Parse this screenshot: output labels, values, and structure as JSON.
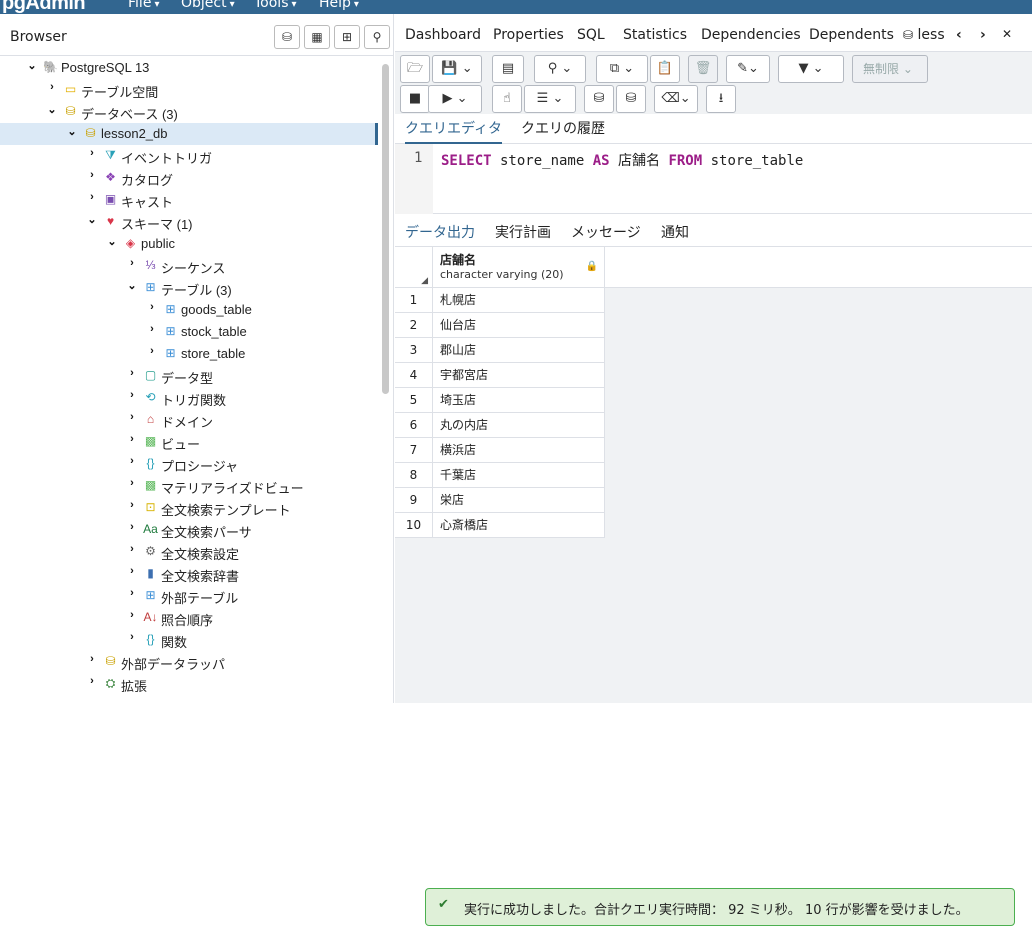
{
  "app": {
    "logo_text": "pgAdmin",
    "menu": [
      {
        "label": "File"
      },
      {
        "label": "Object"
      },
      {
        "label": "Tools"
      },
      {
        "label": "Help"
      }
    ]
  },
  "browser": {
    "title": "Browser",
    "tree": [
      {
        "label": "PostgreSQL 13",
        "icon": "server-icon",
        "expanded": true
      },
      {
        "label": "テーブル空間",
        "icon": "folder-icon",
        "expanded": false
      },
      {
        "label": "データベース (3)",
        "icon": "database-icon",
        "expanded": true
      },
      {
        "label": "lesson2_db",
        "icon": "database-icon",
        "expanded": true,
        "selected": true
      },
      {
        "label": "イベントトリガ",
        "icon": "event-trigger-icon",
        "expanded": false
      },
      {
        "label": "カタログ",
        "icon": "catalog-icon",
        "expanded": false
      },
      {
        "label": "キャスト",
        "icon": "cast-icon",
        "expanded": false
      },
      {
        "label": "スキーマ (1)",
        "icon": "schema-icon",
        "expanded": true
      },
      {
        "label": "public",
        "icon": "schema-public-icon",
        "expanded": true
      },
      {
        "label": "シーケンス",
        "icon": "sequence-icon",
        "expanded": false
      },
      {
        "label": "テーブル (3)",
        "icon": "tables-icon",
        "expanded": true
      },
      {
        "label": "goods_table",
        "icon": "table-icon",
        "expanded": false
      },
      {
        "label": "stock_table",
        "icon": "table-icon",
        "expanded": false
      },
      {
        "label": "store_table",
        "icon": "table-icon",
        "expanded": false
      },
      {
        "label": "データ型",
        "icon": "datatype-icon",
        "expanded": false
      },
      {
        "label": "トリガ関数",
        "icon": "trigger-function-icon",
        "expanded": false
      },
      {
        "label": "ドメイン",
        "icon": "domain-icon",
        "expanded": false
      },
      {
        "label": "ビュー",
        "icon": "view-icon",
        "expanded": false
      },
      {
        "label": "プロシージャ",
        "icon": "procedure-icon",
        "expanded": false
      },
      {
        "label": "マテリアライズドビュー",
        "icon": "materialized-view-icon",
        "expanded": false
      },
      {
        "label": "全文検索テンプレート",
        "icon": "fts-template-icon",
        "expanded": false
      },
      {
        "label": "全文検索パーサ",
        "icon": "fts-parser-icon",
        "expanded": false
      },
      {
        "label": "全文検索設定",
        "icon": "fts-config-icon",
        "expanded": false
      },
      {
        "label": "全文検索辞書",
        "icon": "fts-dictionary-icon",
        "expanded": false
      },
      {
        "label": "外部テーブル",
        "icon": "foreign-table-icon",
        "expanded": false
      },
      {
        "label": "照合順序",
        "icon": "collation-icon",
        "expanded": false
      },
      {
        "label": "関数",
        "icon": "function-icon",
        "expanded": false
      },
      {
        "label": "外部データラッパ",
        "icon": "fdw-icon",
        "expanded": false
      },
      {
        "label": "拡張",
        "icon": "extension-icon",
        "expanded": false
      }
    ]
  },
  "main_tabs": [
    {
      "label": "Dashboard"
    },
    {
      "label": "Properties"
    },
    {
      "label": "SQL"
    },
    {
      "label": "Statistics"
    },
    {
      "label": "Dependencies"
    },
    {
      "label": "Dependents"
    },
    {
      "label": "less"
    }
  ],
  "toolbar": {
    "limit_value": "無制限"
  },
  "query_tabs": [
    {
      "label": "クエリエディタ",
      "active": true
    },
    {
      "label": "クエリの履歴",
      "active": false
    }
  ],
  "editor": {
    "line_number": "1",
    "tokens": {
      "select": "SELECT",
      "col": " store_name ",
      "as": "AS",
      "alias": " 店舗名 ",
      "from": "FROM",
      "table": " store_table"
    }
  },
  "output_tabs": [
    {
      "label": "データ出力",
      "active": true
    },
    {
      "label": "実行計画",
      "active": false
    },
    {
      "label": "メッセージ",
      "active": false
    },
    {
      "label": "通知",
      "active": false
    }
  ],
  "result": {
    "column": {
      "name": "店舗名",
      "type": "character varying (20)"
    },
    "rows": [
      {
        "n": "1",
        "v": "札幌店"
      },
      {
        "n": "2",
        "v": "仙台店"
      },
      {
        "n": "3",
        "v": "郡山店"
      },
      {
        "n": "4",
        "v": "宇都宮店"
      },
      {
        "n": "5",
        "v": "埼玉店"
      },
      {
        "n": "6",
        "v": "丸の内店"
      },
      {
        "n": "7",
        "v": "横浜店"
      },
      {
        "n": "8",
        "v": "千葉店"
      },
      {
        "n": "9",
        "v": "栄店"
      },
      {
        "n": "10",
        "v": "心斎橋店"
      }
    ]
  },
  "status": {
    "message": "実行に成功しました。合計クエリ実行時間： 92 ミリ秒。 10 行が影響を受けました。"
  },
  "colors": {
    "brand": "#326690",
    "success_bg": "#dff0d8",
    "success_border": "#4caf50",
    "keyword": "#9c1e88"
  }
}
